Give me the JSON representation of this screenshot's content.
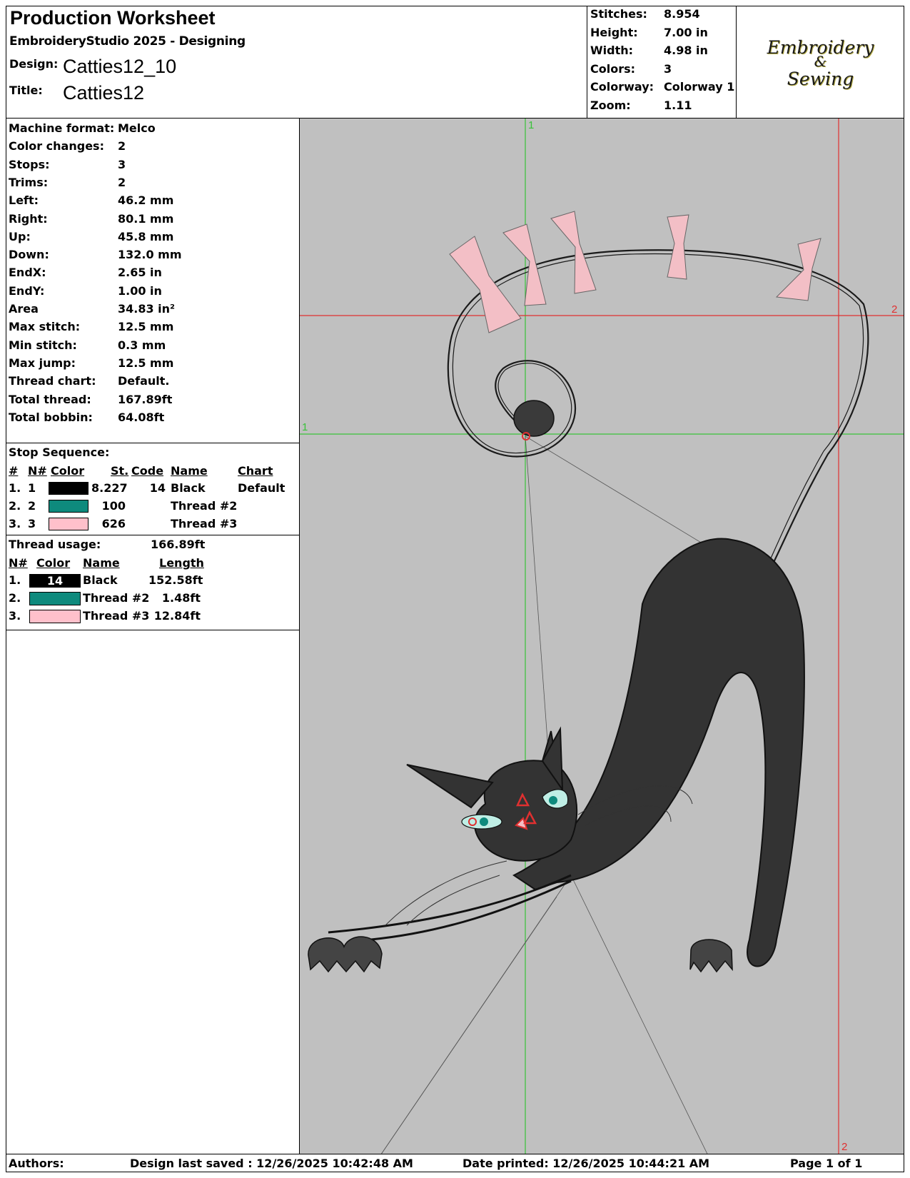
{
  "header": {
    "title": "Production Worksheet",
    "subtitle": "EmbroideryStudio 2025 - Designing",
    "design_label": "Design:",
    "design_value": "Catties12_10",
    "title_label": "Title:",
    "title_value": "Catties12"
  },
  "stats": [
    {
      "label": "Stitches:",
      "value": "8.954"
    },
    {
      "label": "Height:",
      "value": "7.00 in"
    },
    {
      "label": "Width:",
      "value": "4.98 in"
    },
    {
      "label": "Colors:",
      "value": "3"
    },
    {
      "label": "Colorway:",
      "value": "Colorway 1"
    },
    {
      "label": "Zoom:",
      "value": "1.11"
    }
  ],
  "logo": {
    "line1": "Embroidery",
    "line2": "&",
    "line3": "Sewing"
  },
  "details": [
    {
      "label": "Machine format:",
      "value": "Melco"
    },
    {
      "label": "Color changes:",
      "value": "2"
    },
    {
      "label": "Stops:",
      "value": "3"
    },
    {
      "label": "Trims:",
      "value": "2"
    },
    {
      "label": "Left:",
      "value": "46.2 mm"
    },
    {
      "label": "Right:",
      "value": "80.1 mm"
    },
    {
      "label": "Up:",
      "value": "45.8 mm"
    },
    {
      "label": "Down:",
      "value": "132.0 mm"
    },
    {
      "label": "EndX:",
      "value": "2.65 in"
    },
    {
      "label": "EndY:",
      "value": "1.00 in"
    },
    {
      "label": "Area",
      "value": " 34.83 in²"
    },
    {
      "label": "Max stitch:",
      "value": "12.5 mm"
    },
    {
      "label": "Min stitch:",
      "value": "0.3 mm"
    },
    {
      "label": "Max jump:",
      "value": "12.5 mm"
    },
    {
      "label": "Thread chart:",
      "value": "Default."
    },
    {
      "label": "Total thread:",
      "value": "167.89ft"
    },
    {
      "label": "Total bobbin:",
      "value": "64.08ft"
    }
  ],
  "stop_sequence": {
    "title": "Stop Sequence:",
    "headers": {
      "num": "#",
      "n": "N#",
      "color": "Color",
      "st": "St.",
      "code": "Code",
      "name": "Name",
      "chart": "Chart"
    },
    "rows": [
      {
        "num": "1.",
        "n": "1",
        "color": "#000000",
        "st": "8.227",
        "code": "14",
        "name": "Black",
        "chart": "Default"
      },
      {
        "num": "2.",
        "n": "2",
        "color": "#0e8a7d",
        "st": "100",
        "code": "",
        "name": "Thread #2",
        "chart": ""
      },
      {
        "num": "3.",
        "n": "3",
        "color": "#ffc0cb",
        "st": "626",
        "code": "",
        "name": "Thread #3",
        "chart": ""
      }
    ]
  },
  "thread_usage": {
    "label": "Thread usage:",
    "total": "166.89ft",
    "headers": {
      "n": "N#",
      "color": "Color",
      "name": "Name",
      "length": "Length"
    },
    "rows": [
      {
        "n": "1.",
        "color": "#000000",
        "code": "14",
        "name": "Black",
        "length": "152.58ft"
      },
      {
        "n": "2.",
        "color": "#0e8a7d",
        "code": "",
        "name": "Thread #2",
        "length": "1.48ft"
      },
      {
        "n": "3.",
        "color": "#ffc0cb",
        "code": "",
        "name": "Thread #3",
        "length": "12.84ft"
      }
    ]
  },
  "canvas": {
    "background": "#c0c0c0",
    "guide_green": "#39c239",
    "guide_red": "#e03030",
    "marker_labels": {
      "v1": "1",
      "h1": "1",
      "h2": "2",
      "v2": "2"
    }
  },
  "footer": {
    "authors": "Authors:",
    "saved": "Design last saved : 12/26/2025 10:42:48 AM",
    "printed": "Date printed: 12/26/2025 10:44:21 AM",
    "page": "Page 1 of 1"
  }
}
